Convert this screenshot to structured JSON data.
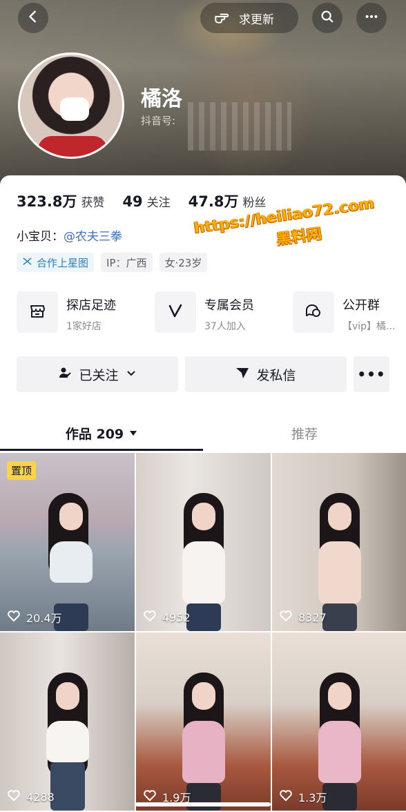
{
  "colors": {
    "accent_link": "#3c6fb4",
    "pin_badge": "#f9d349",
    "watermark": "#ffb000",
    "text_primary": "#161823",
    "text_secondary": "#8a8b91"
  },
  "header": {
    "update_label": "求更新",
    "icons": [
      "back-icon",
      "hand-point-icon",
      "search-icon",
      "more-icon"
    ]
  },
  "profile": {
    "name": "橘洛",
    "douyin_id_label": "抖音号:"
  },
  "stats": [
    {
      "value": "323.8万",
      "label": "获赞"
    },
    {
      "value": "49",
      "label": "关注"
    },
    {
      "value": "47.8万",
      "label": "粉丝"
    }
  ],
  "bio": {
    "prefix": "小宝贝：",
    "mention": "@农夫三拳"
  },
  "tags": [
    "合作上星图",
    "IP：广西",
    "女·23岁"
  ],
  "features": [
    {
      "title": "探店足迹",
      "subtitle": "1家好店",
      "icon": "shop-icon"
    },
    {
      "title": "专属会员",
      "subtitle": "37人加入",
      "icon": "vip-v-icon"
    },
    {
      "title": "公开群",
      "subtitle": "【vip】橘...",
      "icon": "group-chat-icon"
    }
  ],
  "actions": {
    "follow": "已关注",
    "message": "发私信",
    "more": "•••"
  },
  "tabs": {
    "works": "作品 209",
    "recommend": "推荐"
  },
  "watermark": {
    "line1": "https://heiliao72.com",
    "line2": "黑料网"
  },
  "videos": [
    {
      "likes": "20.4万",
      "pinned": "置顶"
    },
    {
      "likes": "4952"
    },
    {
      "likes": "8327"
    },
    {
      "likes": "4288"
    },
    {
      "likes": "1.9万"
    },
    {
      "likes": "1.3万"
    }
  ]
}
